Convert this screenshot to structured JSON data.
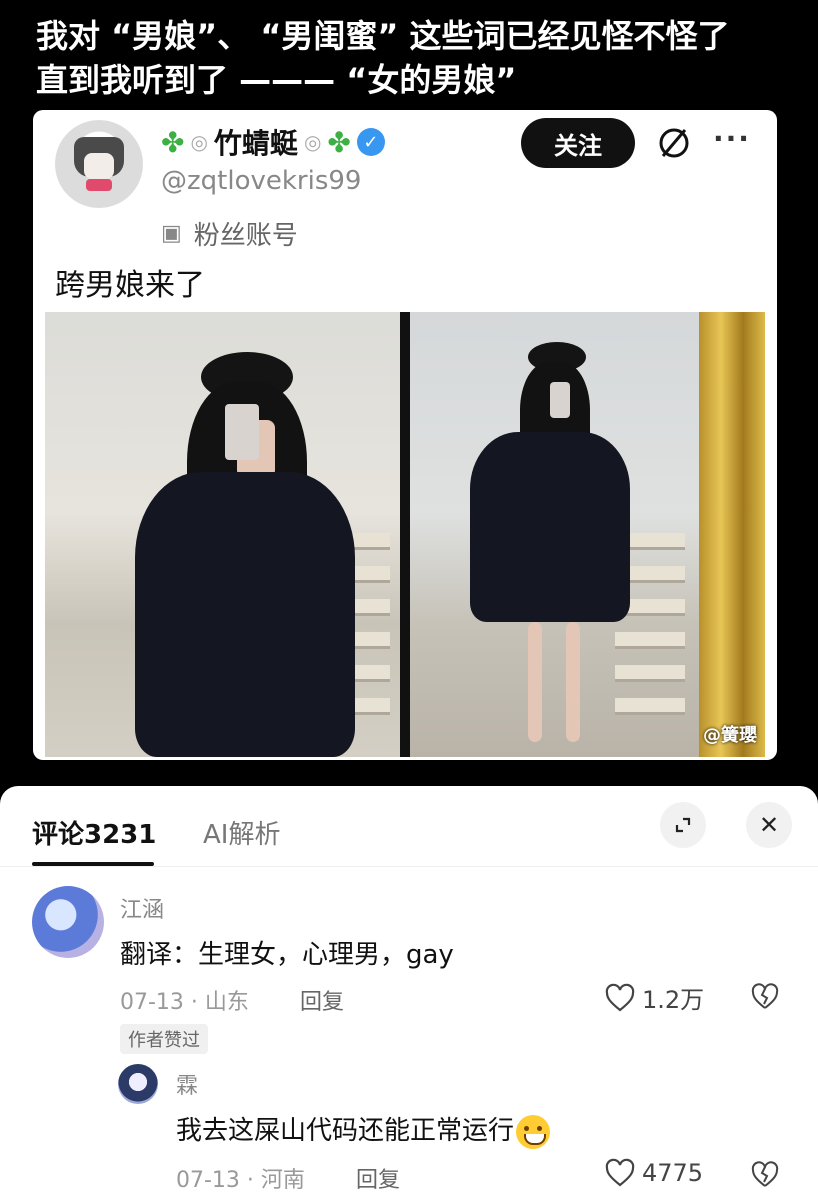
{
  "caption": {
    "line1": "我对 “男娘”、 “男闺蜜” 这些词已经见怪不怪了",
    "line2": "直到我听到了 ——— “女的男娘”"
  },
  "post": {
    "username": "竹蜻蜓",
    "handle": "@zqtlovekris99",
    "fan_label": "粉丝账号",
    "follow_label": "关注",
    "more": "···",
    "text": "跨男娘来了",
    "watermark": "@簧瓔"
  },
  "comments_sheet": {
    "tab_comments": "评论3231",
    "tab_ai": "AI解析",
    "close": "✕",
    "comments": [
      {
        "name": "江涵",
        "text": "翻译：生理女，心理男，gay",
        "date_loc": "07-13 · 山东",
        "reply": "回复",
        "likes": "1.2万",
        "badge": "作者赞过"
      },
      {
        "name": "霖",
        "text": "我去这屎山代码还能正常运行",
        "date_loc": "07-13 · 河南",
        "reply": "回复",
        "likes": "4775"
      }
    ]
  },
  "colors": {
    "background": "#000000",
    "follow_button": "#111111",
    "verified": "#3897f0",
    "clover": "#3cb043"
  }
}
